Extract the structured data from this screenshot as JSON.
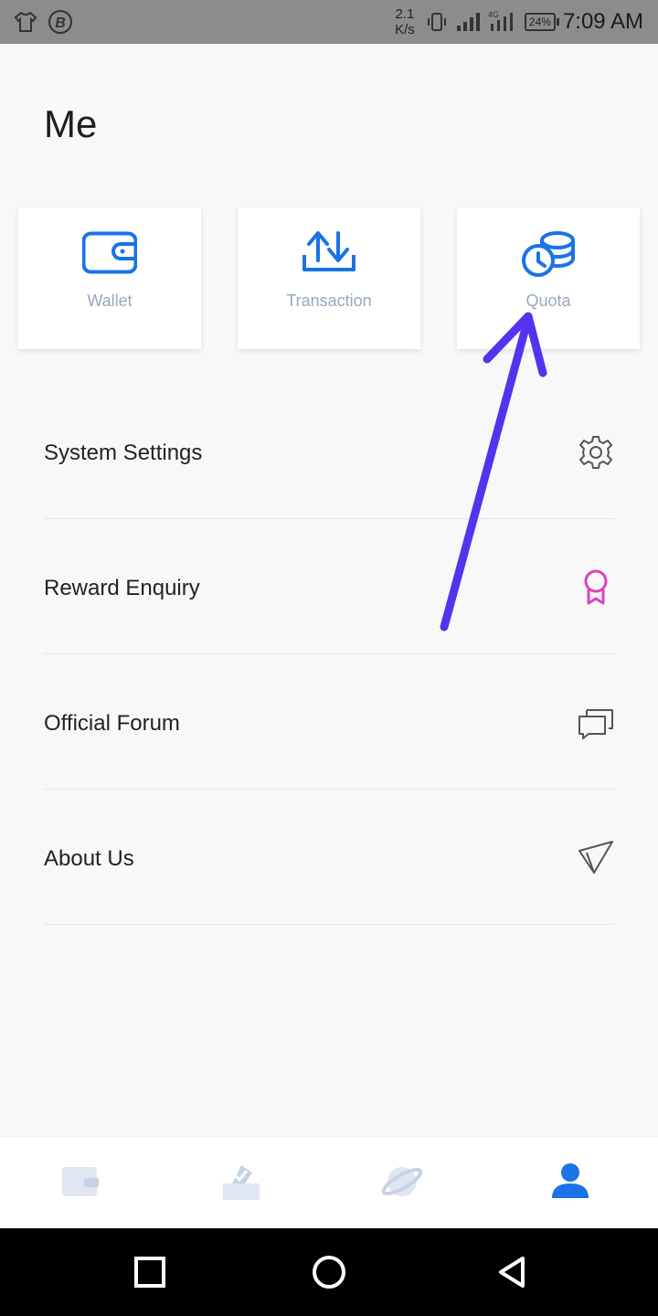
{
  "status_bar": {
    "speed_value": "2.1",
    "speed_unit": "K/s",
    "battery": "24%",
    "time": "7:09 AM"
  },
  "page": {
    "title": "Me"
  },
  "cards": [
    {
      "label": "Wallet",
      "icon": "wallet-icon",
      "color": "#1a73e8"
    },
    {
      "label": "Transaction",
      "icon": "transfer-icon",
      "color": "#1a73e8"
    },
    {
      "label": "Quota",
      "icon": "coins-icon",
      "color": "#1a73e8"
    }
  ],
  "menu": [
    {
      "label": "System Settings",
      "icon": "gear-icon"
    },
    {
      "label": "Reward Enquiry",
      "icon": "award-icon",
      "color": "#e040c0"
    },
    {
      "label": "Official Forum",
      "icon": "chat-icon"
    },
    {
      "label": "About Us",
      "icon": "paper-plane-icon"
    }
  ],
  "annotation": {
    "color": "#5533ee",
    "points_to": "Quota"
  },
  "tabbar": {
    "tabs": [
      "wallet-tab-icon",
      "vote-tab-icon",
      "planet-tab-icon",
      "profile-tab-icon"
    ],
    "active_index": 3,
    "active_color": "#1a73e8",
    "inactive_color": "#dfe6f2"
  }
}
